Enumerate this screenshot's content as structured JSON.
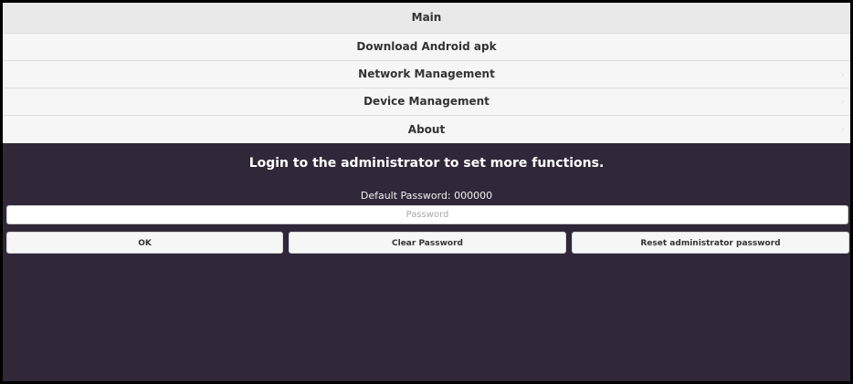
{
  "menu": {
    "items": [
      {
        "label": "Main"
      },
      {
        "label": "Download Android apk"
      },
      {
        "label": "Network Management",
        "icon": "chevron-right-icon"
      },
      {
        "label": "Device Management",
        "icon": "chevron-right-icon"
      },
      {
        "label": "About",
        "icon": "chevron-right-icon"
      }
    ]
  },
  "login": {
    "title": "Login to the administrator to set more functions.",
    "default_password_text": "Default Password: 000000",
    "password_placeholder": "Password",
    "ok_label": "OK",
    "clear_label": "Clear Password",
    "reset_label": "Reset administrator password"
  },
  "colors": {
    "panel_background": "#302839",
    "menu_background": "#f6f6f6",
    "main_item_background": "#e9e9e9"
  }
}
